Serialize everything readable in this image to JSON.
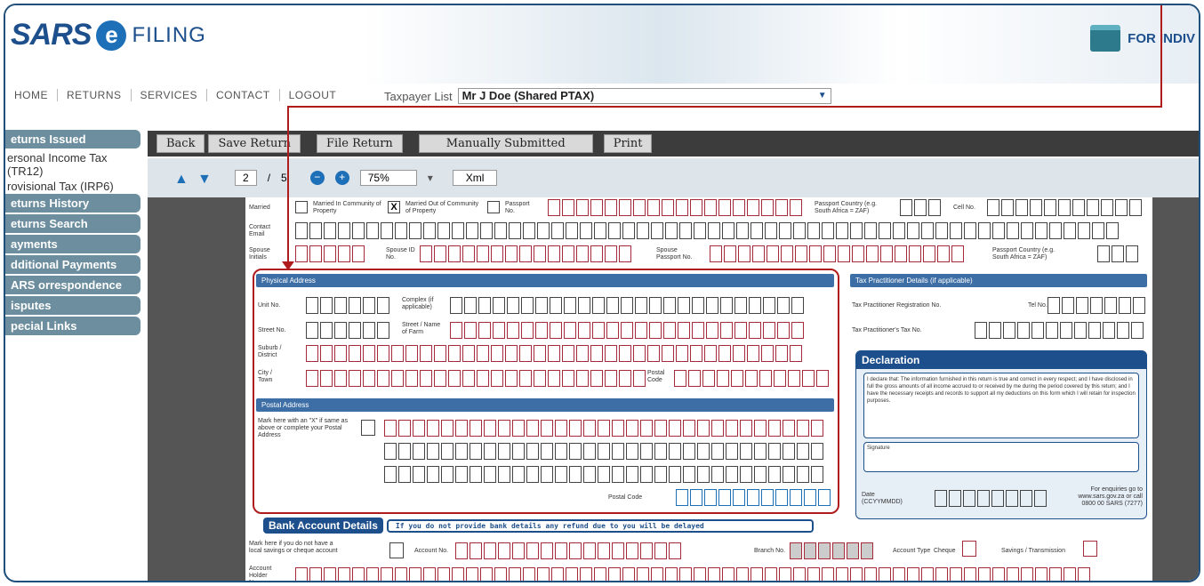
{
  "header": {
    "logo_sars": "SARS",
    "logo_e": "e",
    "logo_filing": "FILING",
    "for_individuals": "FOR INDIV"
  },
  "nav": {
    "items": [
      "HOME",
      "RETURNS",
      "SERVICES",
      "CONTACT",
      "LOGOUT"
    ]
  },
  "taxpayer": {
    "label": "Taxpayer List",
    "selected": "Mr J Doe (Shared PTAX)"
  },
  "sidebar": {
    "items": [
      {
        "label": "eturns Issued",
        "subs": [
          "ersonal Income Tax (TR12)",
          "rovisional Tax (IRP6)"
        ]
      },
      {
        "label": "eturns History",
        "subs": []
      },
      {
        "label": "eturns Search",
        "subs": []
      },
      {
        "label": "ayments",
        "subs": []
      },
      {
        "label": "dditional Payments",
        "subs": []
      },
      {
        "label": "ARS orrespondence",
        "subs": []
      },
      {
        "label": "isputes",
        "subs": []
      },
      {
        "label": "pecial Links",
        "subs": []
      }
    ]
  },
  "toolbar": {
    "back": "Back",
    "save": "Save Return",
    "file": "File Return",
    "manual": "Manually Submitted",
    "print": "Print"
  },
  "pdf": {
    "page": "2",
    "sep": "/",
    "total": "5",
    "zoom": "75%",
    "xml": "Xml"
  },
  "form": {
    "married_label": "Married",
    "in_community": "Married In Community of Property",
    "out_community": "Married Out of Community of Property",
    "passport_no": "Passport No.",
    "passport_country": "Passport Country (e.g. South Africa = ZAF)",
    "cell": "Cell No.",
    "contact_email": "Contact Email",
    "spouse_initials": "Spouse Initials",
    "spouse_id": "Spouse ID No.",
    "spouse_passport": "Spouse Passport No.",
    "passport_country2": "Passport Country (e.g. South Africa = ZAF)",
    "physical_address": "Physical Address",
    "unit_no": "Unit No.",
    "complex": "Complex (if applicable)",
    "street_no": "Street No.",
    "street_name": "Street / Name of Farm",
    "suburb": "Suburb / District",
    "city": "City / Town",
    "postal_code": "Postal Code",
    "postal_address": "Postal Address",
    "postal_mark": "Mark here with an \"X\" if same as above or complete your Postal Address",
    "postal_code2": "Postal Code",
    "tax_practitioner": "Tax Practitioner Details (if applicable)",
    "tp_reg": "Tax Practitioner Registration No.",
    "tp_tel": "Tel No.",
    "tp_taxno": "Tax Practitioner's Tax No.",
    "declaration": "Declaration",
    "decl_text": "I declare that: The information furnished in this return is true and correct in every respect; and I have disclosed in full the gross amounts of all income accrued to or received by me during the period covered by this return; and I have the necessary receipts and records to support all my deductions on this form which I will retain for inspection purposes.",
    "signature": "Signature",
    "date_label": "Date (CCYYMMDD)",
    "enquiries": "For enquiries go to www.sars.gov.za or call 0800 00 SARS (7277)",
    "bank_title": "Bank Account Details",
    "bank_note": "If you do not provide bank details any refund due to you will be delayed",
    "bank_mark": "Mark here if you do not have a local savings or cheque account",
    "account_no": "Account No.",
    "branch_no": "Branch No.",
    "account_type": "Account Type",
    "cheque": "Cheque",
    "savings": "Savings / Transmission",
    "holder": "Account Holder Name",
    "x_mark": "X"
  }
}
